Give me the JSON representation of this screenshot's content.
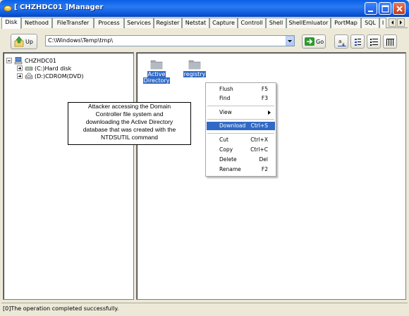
{
  "window": {
    "title": "[ CHZHDC01 ]Manager"
  },
  "tabs": [
    {
      "label": "Disk",
      "active": true
    },
    {
      "label": "Nethood"
    },
    {
      "label": "FileTransfer"
    },
    {
      "label": "Process"
    },
    {
      "label": "Services"
    },
    {
      "label": "Register"
    },
    {
      "label": "Netstat"
    },
    {
      "label": "Capture"
    },
    {
      "label": "Controll"
    },
    {
      "label": "Shell"
    },
    {
      "label": "ShellEmluator"
    },
    {
      "label": "PortMap"
    },
    {
      "label": "SQL"
    },
    {
      "label": "I"
    }
  ],
  "toolbar": {
    "up_label": "Up",
    "path_value": "C:\\Windows\\Temp\\tmp\\",
    "go_label": "Go"
  },
  "tree": {
    "root": "CHZHDC01",
    "items": [
      {
        "label": "(C:)Hard disk",
        "icon": "hard-disk-icon"
      },
      {
        "label": "(D:)CDROM(DVD)",
        "icon": "cdrom-icon"
      }
    ]
  },
  "files": [
    {
      "label_line1": "Active",
      "label_line2": "Directory",
      "selected": true
    },
    {
      "label_line1": "registry",
      "label_line2": "",
      "selected": true
    }
  ],
  "context_menu": {
    "items": [
      {
        "label": "Flush",
        "shortcut": "F5"
      },
      {
        "label": "Find",
        "shortcut": "F3"
      },
      {
        "label": "View",
        "shortcut": "",
        "submenu": true
      },
      {
        "label": "Download",
        "shortcut": "Ctrl+S",
        "highlighted": true
      },
      {
        "label": "Cut",
        "shortcut": "Ctrl+X"
      },
      {
        "label": "Copy",
        "shortcut": "Ctrl+C"
      },
      {
        "label": "Delete",
        "shortcut": "Del"
      },
      {
        "label": "Rename",
        "shortcut": "F2"
      }
    ]
  },
  "annotation": {
    "lines": [
      "Attacker accessing the Domain",
      "Controller file system and",
      "downloading the Active Directory",
      "database that was created with the",
      "NTDSUTIL command"
    ]
  },
  "status": {
    "text": "[0]The operation completed successfully."
  },
  "colors": {
    "title_bar": "#0a5fe6",
    "selection": "#316ac5",
    "face": "#ece9d8"
  }
}
